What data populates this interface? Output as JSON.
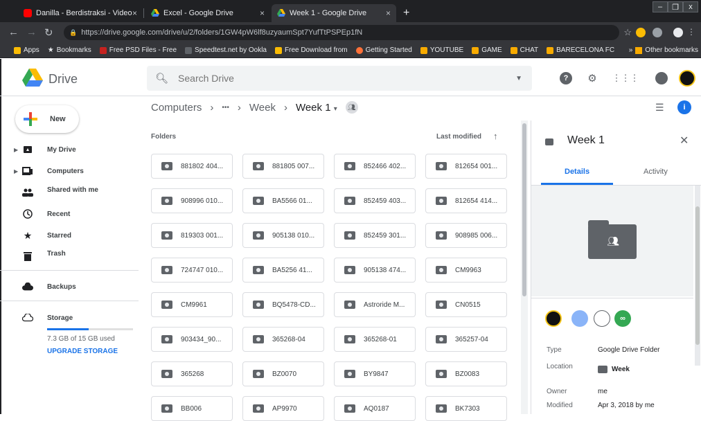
{
  "browser": {
    "tabs": [
      {
        "title": "Danilla - Berdistraksi - Video Lirik",
        "favicon_color": "#ff0000"
      },
      {
        "title": "Excel - Google Drive",
        "favicon_color": "#fbbc04"
      },
      {
        "title": "Week 1 - Google Drive",
        "favicon_color": "#fbbc04"
      }
    ],
    "close_glyph": "×",
    "new_tab_glyph": "+",
    "window_controls": [
      "–",
      "❐",
      "x"
    ],
    "url": "https://drive.google.com/drive/u/2/folders/1GW4pW6lf8uzyaumSpt7YufTtPSPEp1fN",
    "bookmarks": [
      {
        "label": "Apps",
        "color": "#fbbc04"
      },
      {
        "label": "Bookmarks",
        "color": "#e8eaed"
      },
      {
        "label": "Free PSD Files - Free",
        "color": "#c5221f"
      },
      {
        "label": "Speedtest.net by Ookla",
        "color": "#5f6368"
      },
      {
        "label": "Free Download from",
        "color": "#fbbc04"
      },
      {
        "label": "Getting Started",
        "color": "#ff7139"
      },
      {
        "label": "YOUTUBE",
        "color": "#f9ab00"
      },
      {
        "label": "GAME",
        "color": "#f9ab00"
      },
      {
        "label": "CHAT",
        "color": "#f9ab00"
      },
      {
        "label": "BARECELONA FC",
        "color": "#f9ab00"
      }
    ],
    "other_bookmarks": "Other bookmarks",
    "overflow": "»"
  },
  "header": {
    "brand": "Drive",
    "search_placeholder": "Search Drive"
  },
  "sidebar": {
    "new_label": "New",
    "items": [
      {
        "label": "My Drive",
        "icon": "my-drive-icon"
      },
      {
        "label": "Computers",
        "icon": "computers-icon"
      },
      {
        "label": "Shared with me",
        "icon": "shared-icon"
      },
      {
        "label": "Recent",
        "icon": "clock-icon"
      },
      {
        "label": "Starred",
        "icon": "star-icon"
      },
      {
        "label": "Trash",
        "icon": "trash-icon"
      },
      {
        "label": "Backups",
        "icon": "cloud-icon"
      },
      {
        "label": "Storage",
        "icon": "cloud-outline-icon"
      }
    ],
    "storage_text": "7.3 GB of 15 GB used",
    "storage_fraction": 0.487,
    "upgrade": "UPGRADE STORAGE"
  },
  "main": {
    "breadcrumb": [
      "Computers",
      "•••",
      "Week",
      "Week 1"
    ],
    "section_title": "Folders",
    "sort_label": "Last modified",
    "folders": [
      "881802 404...",
      "881805 007...",
      "852466 402...",
      "812654 001...",
      "908996 010...",
      "BA5566 01...",
      "852459 403...",
      "812654 414...",
      "819303 001...",
      "905138 010...",
      "852459 301...",
      "908985 006...",
      "724747 010...",
      "BA5256 41...",
      "905138 474...",
      "CM9963",
      "CM9961",
      "BQ5478-CD...",
      "Astroride M...",
      "CN0515",
      "903434_90...",
      "365268-04",
      "365268-01",
      "365257-04",
      "365268",
      "BZ0070",
      "BY9847",
      "BZ0083",
      "BB006",
      "AP9970",
      "AQ0187",
      "BK7303"
    ]
  },
  "details": {
    "title": "Week 1",
    "tabs": [
      "Details",
      "Activity"
    ],
    "type_label": "Type",
    "type_value": "Google Drive Folder",
    "location_label": "Location",
    "location_value": "Week",
    "owner_label": "Owner",
    "owner_value": "me",
    "modified_label": "Modified",
    "modified_value": "Apr 3, 2018 by me"
  },
  "colors": {
    "accent": "#1a73e8",
    "chrome_dark": "#202124"
  }
}
